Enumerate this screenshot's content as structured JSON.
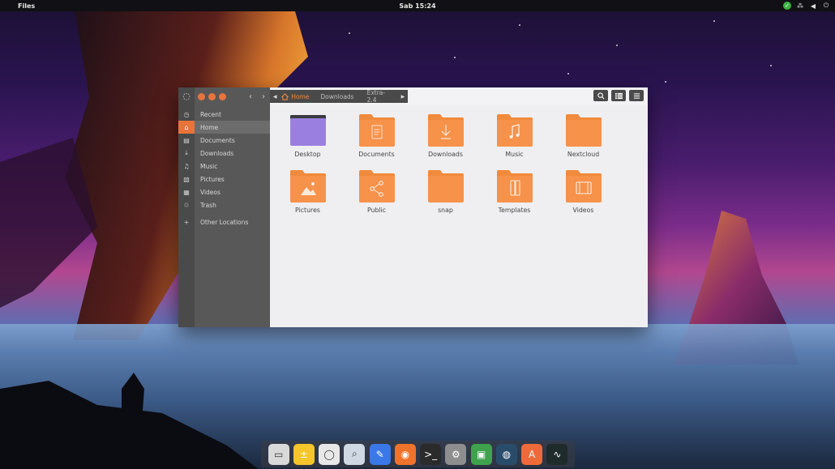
{
  "topbar": {
    "app_name": "Files",
    "clock": "Sab 15:24"
  },
  "sidebar": {
    "items": [
      {
        "label": "Recent",
        "icon": "clock-icon",
        "glyph": "◷"
      },
      {
        "label": "Home",
        "icon": "home-icon",
        "glyph": "⌂"
      },
      {
        "label": "Documents",
        "icon": "document-icon",
        "glyph": "▤"
      },
      {
        "label": "Downloads",
        "icon": "download-icon",
        "glyph": "⤓"
      },
      {
        "label": "Music",
        "icon": "music-icon",
        "glyph": "♫"
      },
      {
        "label": "Pictures",
        "icon": "picture-icon",
        "glyph": "▧"
      },
      {
        "label": "Videos",
        "icon": "film-icon",
        "glyph": "▦"
      },
      {
        "label": "Trash",
        "icon": "trash-icon",
        "glyph": "♲"
      }
    ],
    "other_locations": {
      "label": "Other Locations",
      "glyph": "+"
    }
  },
  "pathbar": {
    "segments": [
      "Home",
      "Downloads",
      "Extra-2.4"
    ]
  },
  "folders": [
    {
      "label": "Desktop",
      "kind": "desktop"
    },
    {
      "label": "Documents",
      "kind": "documents"
    },
    {
      "label": "Downloads",
      "kind": "downloads"
    },
    {
      "label": "Music",
      "kind": "music"
    },
    {
      "label": "Nextcloud",
      "kind": "plain"
    },
    {
      "label": "Pictures",
      "kind": "pictures"
    },
    {
      "label": "Public",
      "kind": "public"
    },
    {
      "label": "snap",
      "kind": "plain"
    },
    {
      "label": "Templates",
      "kind": "templates"
    },
    {
      "label": "Videos",
      "kind": "videos"
    }
  ],
  "colors": {
    "accent": "#e8743b",
    "folder_top": "#f7924a",
    "folder_bottom": "#f4734a",
    "desktop_folder": "#9b7fe0"
  },
  "dock": [
    {
      "name": "files-app-icon",
      "bg": "#d9d9d9",
      "glyph": "▭"
    },
    {
      "name": "notes-app-icon",
      "bg": "#f5c52b",
      "glyph": "±"
    },
    {
      "name": "clock-app-icon",
      "bg": "#e8e8e8",
      "glyph": "◯"
    },
    {
      "name": "image-viewer-icon",
      "bg": "#cfd8e3",
      "glyph": "⌕"
    },
    {
      "name": "text-editor-icon",
      "bg": "#3b78e7",
      "glyph": "✎"
    },
    {
      "name": "firefox-icon",
      "bg": "#f0732b",
      "glyph": "◉"
    },
    {
      "name": "terminal-icon",
      "bg": "#2b2b2b",
      "glyph": ">_"
    },
    {
      "name": "settings-icon",
      "bg": "#8e8e8e",
      "glyph": "⚙"
    },
    {
      "name": "system-monitor-icon",
      "bg": "#3fa34d",
      "glyph": "▣"
    },
    {
      "name": "steam-icon",
      "bg": "#2a4c6b",
      "glyph": "◍"
    },
    {
      "name": "software-center-icon",
      "bg": "#ef6a3a",
      "glyph": "A"
    },
    {
      "name": "activity-monitor-icon",
      "bg": "#1f2a2a",
      "glyph": "∿"
    }
  ]
}
